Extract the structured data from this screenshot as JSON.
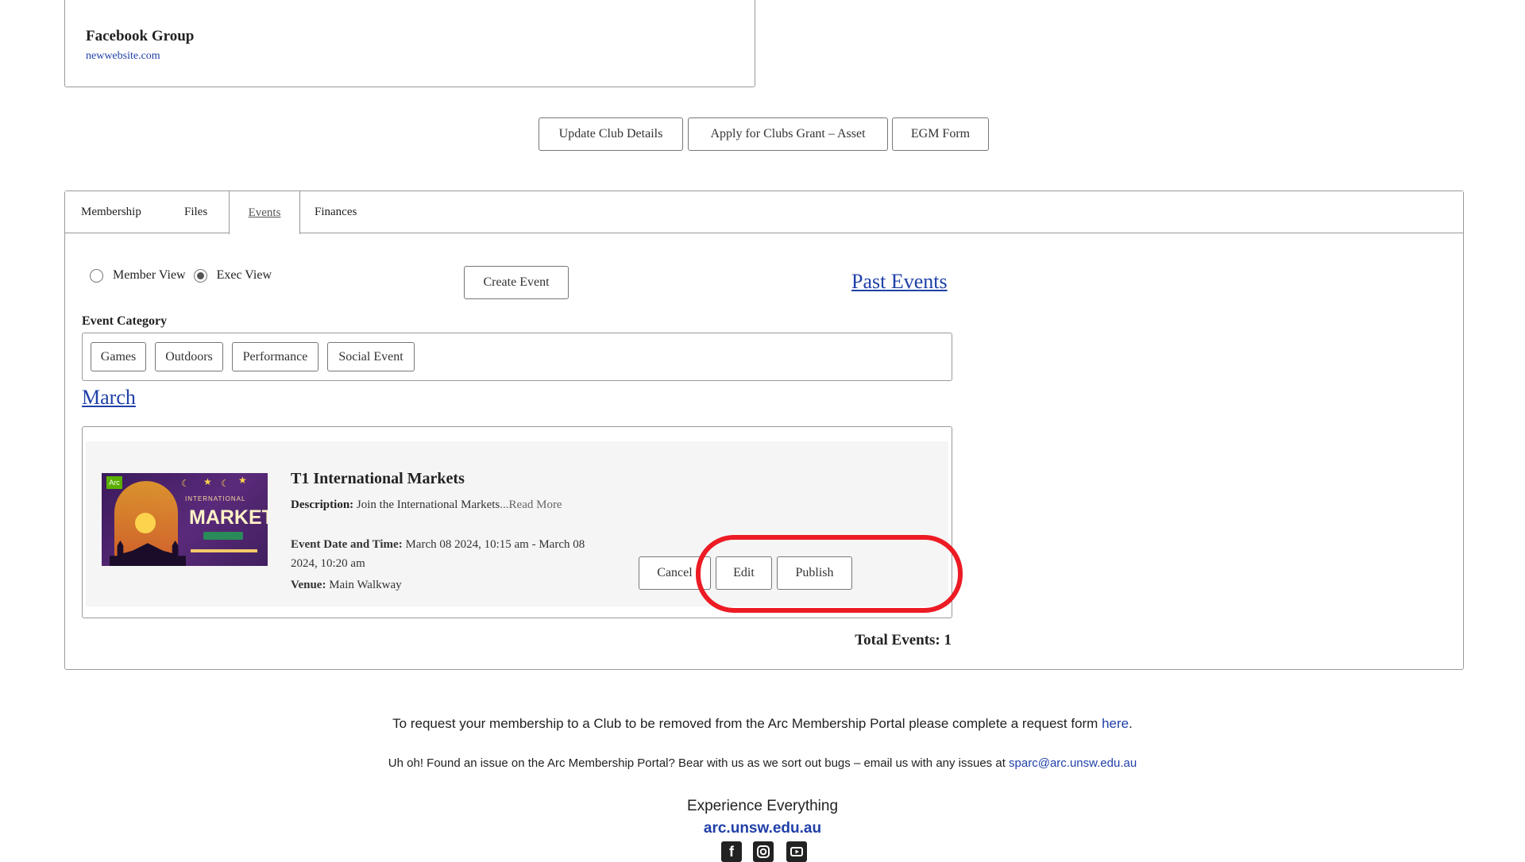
{
  "top_card": {
    "title": "Facebook Group",
    "link": "newwebsite.com"
  },
  "actions": {
    "update": "Update Club Details",
    "grant": "Apply for Clubs Grant – Asset",
    "egm": "EGM Form"
  },
  "tabs": [
    {
      "label": "Membership"
    },
    {
      "label": "Files"
    },
    {
      "label": "Events",
      "active": true
    },
    {
      "label": "Finances"
    }
  ],
  "view": {
    "member_label": "Member View",
    "exec_label": "Exec View",
    "selected": "Exec View"
  },
  "create_event": "Create Event",
  "past_events": "Past Events",
  "category": {
    "label": "Event Category",
    "items": [
      "Games",
      "Outdoors",
      "Performance",
      "Social Event"
    ]
  },
  "month": "March",
  "event": {
    "title": "T1 International Markets",
    "desc_label": "Description:",
    "desc": "Join the International Markets",
    "read_more": "...Read More",
    "date_label": "Event Date and Time:",
    "date_value": "March 08 2024, 10:15 am - March 08 2024, 10:20 am",
    "venue_label": "Venue:",
    "venue": "Main Walkway",
    "poster_brand": "Arc",
    "poster_line1": "INTERNATIONAL",
    "poster_line2": "MARKETS",
    "buttons": {
      "cancel": "Cancel",
      "edit": "Edit",
      "publish": "Publish"
    }
  },
  "total_events": "Total Events: 1",
  "footer": {
    "line1_text": "To request your membership to a Club to be removed from the Arc Membership Portal please complete a request form ",
    "line1_link": "here",
    "line1_end": ".",
    "line2_text": "Uh oh! Found an issue on the Arc Membership Portal? Bear with us as we sort out bugs – email us with any issues at ",
    "line2_link": "sparc@arc.unsw.edu.au",
    "tagline": "Experience Everything",
    "site": "arc.unsw.edu.au"
  },
  "social_icons": [
    "facebook-icon",
    "instagram-icon",
    "youtube-icon"
  ],
  "colors": {
    "link": "#1f3fa8",
    "highlight": "#ec1b24"
  }
}
